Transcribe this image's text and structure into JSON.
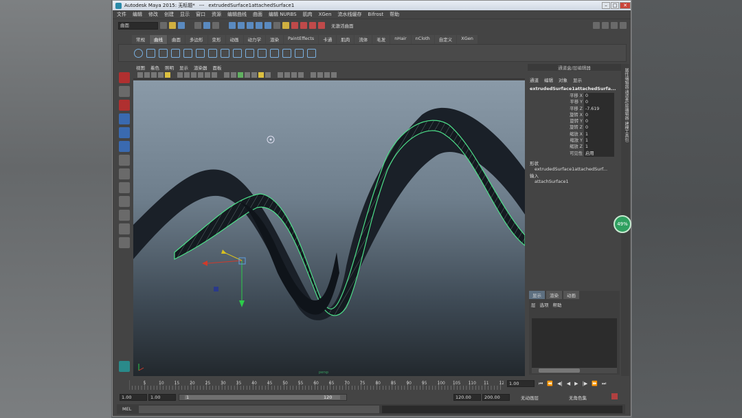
{
  "window": {
    "app_title": "Autodesk Maya 2015: 无标题*",
    "separator": "---",
    "object_title": "extrudedSurface1attachedSurface1",
    "buttons": [
      "–",
      "□",
      "✕"
    ]
  },
  "menubar": [
    "文件",
    "编辑",
    "修改",
    "创建",
    "显示",
    "窗口",
    "资源",
    "编辑曲线",
    "曲面",
    "编辑 NURBS",
    "肌肉",
    "XGen",
    "流水线缓存",
    "Bifrost",
    "帮助"
  ],
  "toolbar": {
    "mode_combo": "曲面",
    "status_text": "无激活曲面"
  },
  "shelf_tabs": [
    "常规",
    "曲线",
    "曲面",
    "多边形",
    "变形",
    "动画",
    "动力学",
    "渲染",
    "PaintEffects",
    "卡通",
    "肌肉",
    "流体",
    "毛发",
    "nHair",
    "nCloth",
    "自定义",
    "XGen"
  ],
  "shelf_active": "曲线",
  "viewport": {
    "menu": [
      "视图",
      "着色",
      "照明",
      "显示",
      "渲染器",
      "面板"
    ],
    "axis_label": "persp"
  },
  "channel_box": {
    "title": "通道盒/层编辑器",
    "tabs": [
      "通道",
      "编辑",
      "对象",
      "显示"
    ],
    "object_name": "extrudedSurface1attachedSurfa...",
    "attributes": [
      {
        "name": "平移 X",
        "value": "0"
      },
      {
        "name": "平移 Y",
        "value": "0"
      },
      {
        "name": "平移 Z",
        "value": "-7.619"
      },
      {
        "name": "旋转 X",
        "value": "0"
      },
      {
        "name": "旋转 Y",
        "value": "0"
      },
      {
        "name": "旋转 Z",
        "value": "0"
      },
      {
        "name": "缩放 X",
        "value": "1"
      },
      {
        "name": "缩放 Y",
        "value": "1"
      },
      {
        "name": "缩放 Z",
        "value": "1"
      },
      {
        "name": "可见性",
        "value": "启用"
      }
    ],
    "shapes_label": "形状",
    "shape_name": "extrudedSurface1attachedSurf...",
    "inputs_label": "输入",
    "input_name": "attachSurface1"
  },
  "layer_editor": {
    "tabs": [
      "显示",
      "渲染",
      "动画"
    ],
    "menu": [
      "层",
      "选项",
      "帮助"
    ]
  },
  "side_tabs": "属性编辑器 通道盒/层编辑器 建模工具包",
  "timeline": {
    "tick_labels": [
      "5",
      "10",
      "15",
      "20",
      "25",
      "30",
      "35",
      "40",
      "45",
      "50",
      "55",
      "60",
      "65",
      "70",
      "75",
      "80",
      "85",
      "90",
      "95",
      "100",
      "105",
      "110",
      "11",
      "12"
    ],
    "current_frame": "1.00",
    "play_buttons": [
      "⏮",
      "⏪",
      "◀|",
      "◀",
      "▶",
      "|▶",
      "⏩",
      "⏭"
    ]
  },
  "range": {
    "start": "1.00",
    "start2": "1.00",
    "slider_start": "1",
    "slider_end": "120",
    "end": "120.00",
    "end2": "200.00",
    "anim_layer": "无动画层",
    "char_set": "无角色集"
  },
  "cmdline": {
    "label": "MEL"
  },
  "badge": {
    "text": "49%"
  }
}
